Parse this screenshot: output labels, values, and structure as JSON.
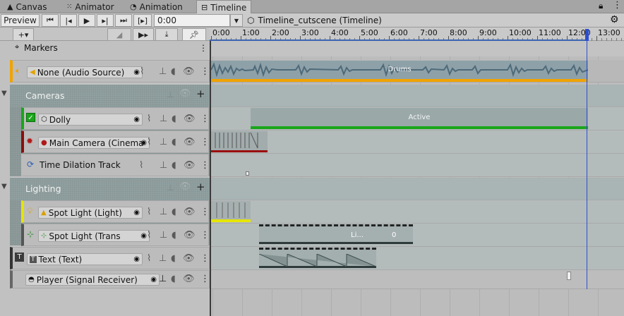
{
  "tabs": [
    {
      "label": "Canvas",
      "icon": "canvas-icon"
    },
    {
      "label": "Animator",
      "icon": "animator-icon"
    },
    {
      "label": "Animation",
      "icon": "animation-icon"
    },
    {
      "label": "Timeline",
      "icon": "timeline-icon",
      "active": true
    }
  ],
  "toolbar": {
    "preview_label": "Preview",
    "current_time": "0:00",
    "asset_name": "Timeline_cutscene (Timeline)",
    "frame_btn_label": "[▸]"
  },
  "header2": {
    "add_label": "+▾"
  },
  "ruler": {
    "labels": [
      "0:00",
      "1:00",
      "2:00",
      "3:00",
      "4:00",
      "5:00",
      "6:00",
      "7:00",
      "8:00",
      "9:00",
      "10:00",
      "11:00",
      "12:00",
      "13:00"
    ]
  },
  "markers_label": "Markers",
  "tracks": {
    "audio": {
      "name": "None (Audio Source)",
      "clip_label": "Drums"
    },
    "cameras_group": {
      "name": "Cameras"
    },
    "dolly": {
      "name": "Dolly",
      "clip_label": "Active"
    },
    "main_camera": {
      "name": "Main Camera (Cinema"
    },
    "time_dilation": {
      "name": "Time Dilation Track"
    },
    "lighting_group": {
      "name": "Lighting"
    },
    "spot_light": {
      "name": "Spot Light (Light)"
    },
    "spot_light_trans": {
      "name": "Spot Light (Trans",
      "clip_labels": [
        "Li...",
        "0"
      ]
    },
    "text": {
      "name": "Text (Text)"
    },
    "player": {
      "name": "Player (Signal Receiver)"
    }
  },
  "colors": {
    "audio_accent": "#f0a300",
    "dolly_accent": "#1aa51a",
    "camera_accent": "#8a0f0f",
    "light_accent": "#e5e500",
    "playhead": "#2b4fd0"
  }
}
